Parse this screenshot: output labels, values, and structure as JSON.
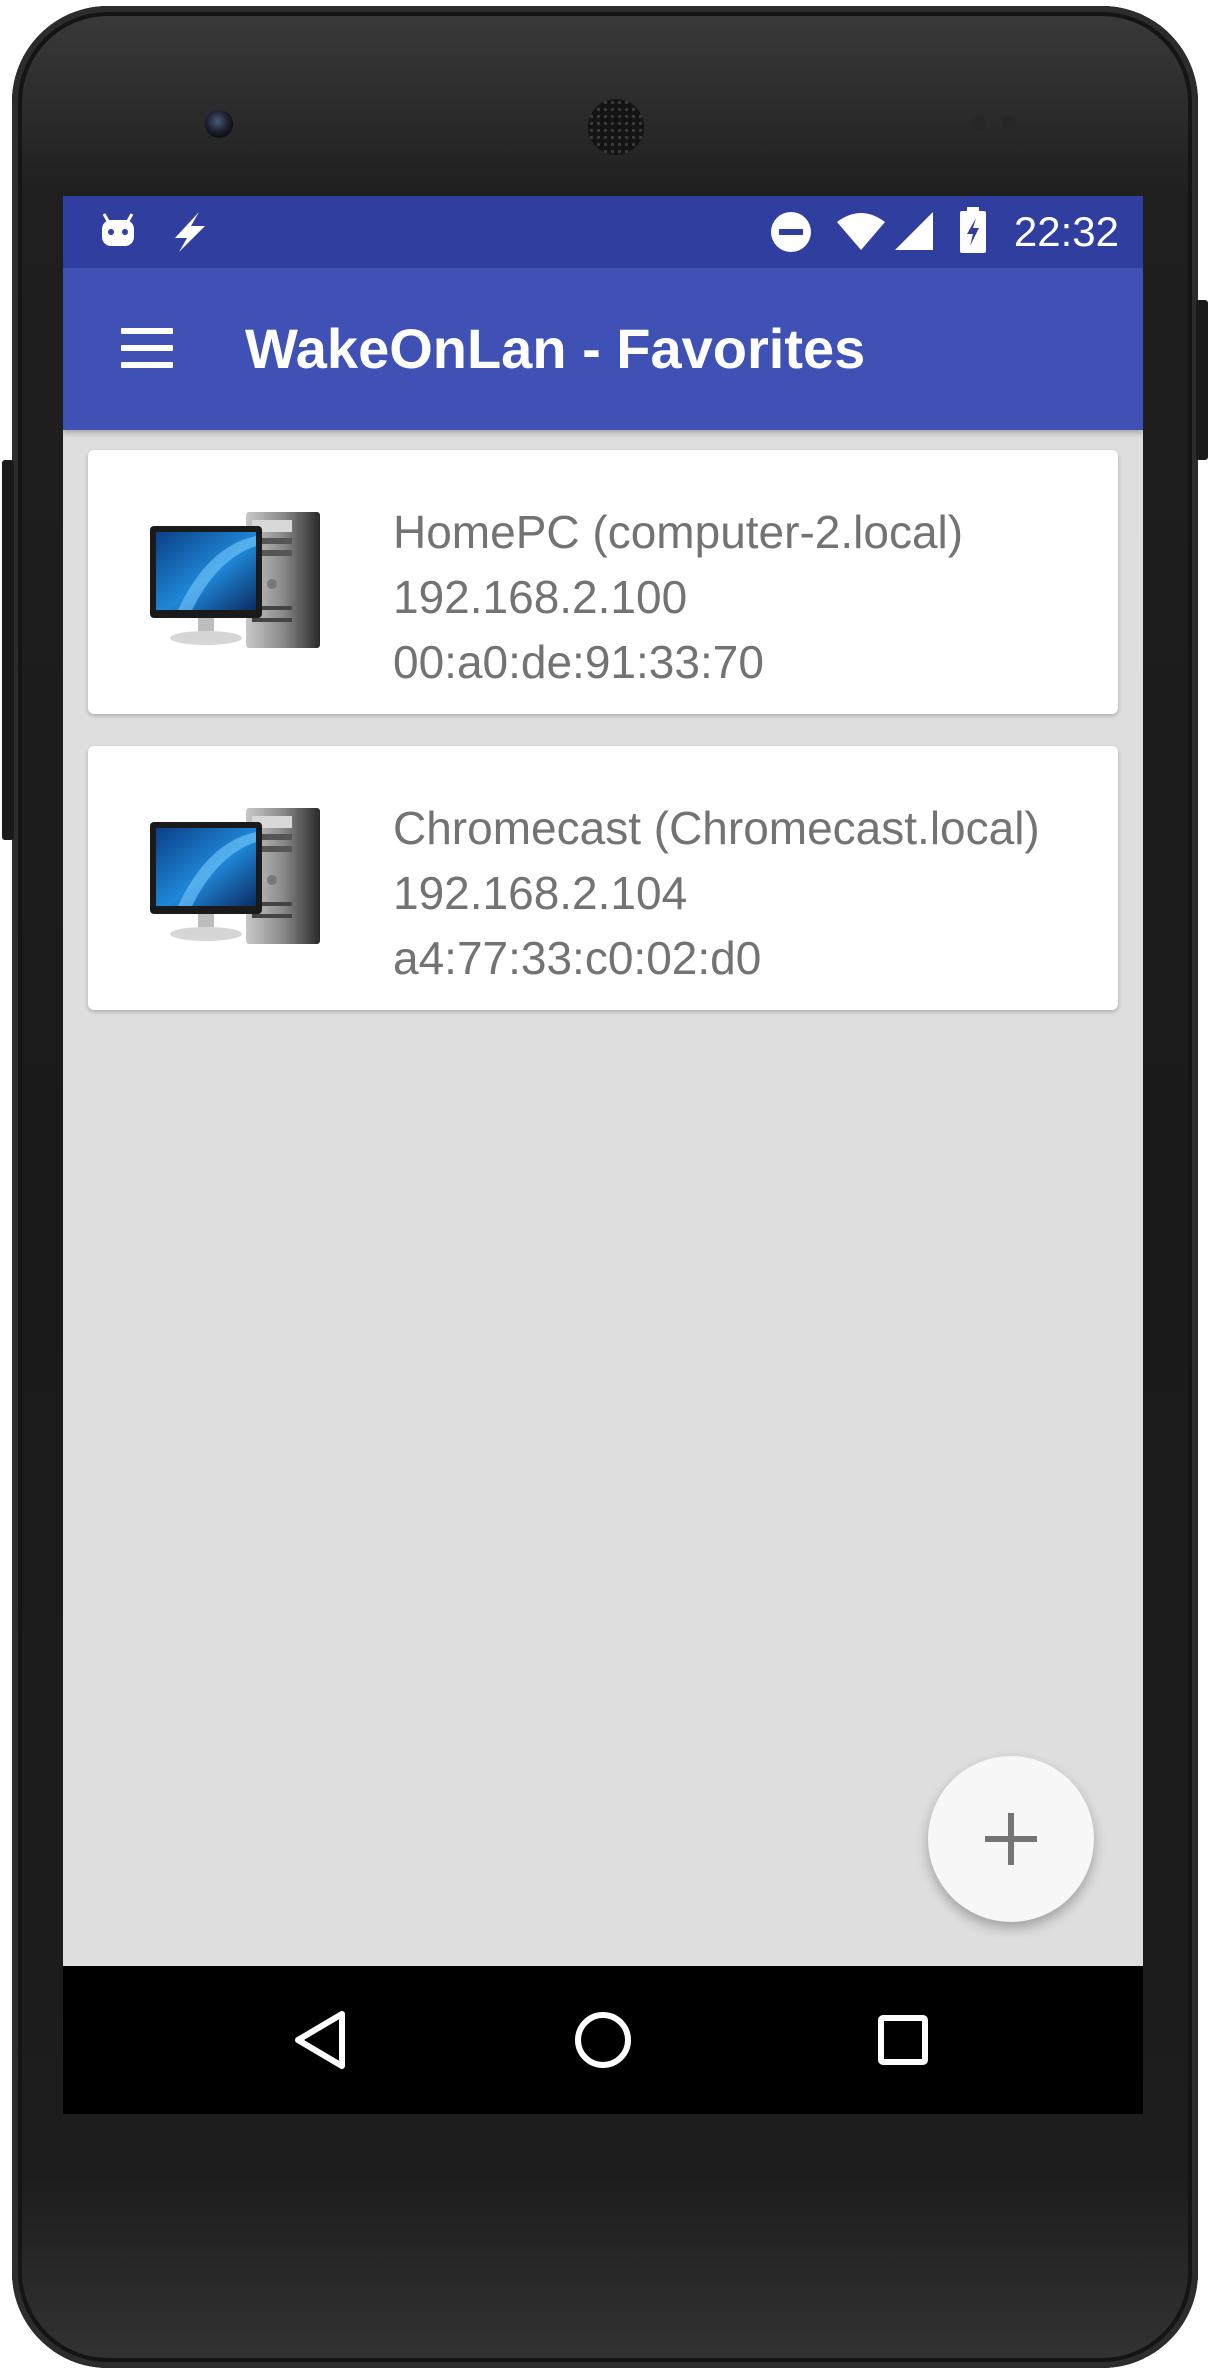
{
  "status_bar": {
    "time": "22:32",
    "left_icons": [
      "android-icon",
      "flash-icon"
    ],
    "right_icons": [
      "do-not-disturb-icon",
      "wifi-icon",
      "cell-signal-icon",
      "battery-charging-icon"
    ]
  },
  "toolbar": {
    "menu_icon": "hamburger-menu-icon",
    "title": "WakeOnLan - Favorites"
  },
  "favorites": [
    {
      "name": "HomePC (computer-2.local)",
      "ip": "192.168.2.100",
      "mac": "00:a0:de:91:33:70",
      "icon": "desktop-computer-icon"
    },
    {
      "name": "Chromecast (Chromecast.local)",
      "ip": "192.168.2.104",
      "mac": "a4:77:33:c0:02:d0",
      "icon": "desktop-computer-icon"
    }
  ],
  "fab": {
    "icon": "plus-icon"
  },
  "nav_bar": {
    "icons": [
      "back-icon",
      "home-icon",
      "recents-icon"
    ]
  },
  "colors": {
    "status_bar": "#303f9f",
    "toolbar": "#3f51b5",
    "background": "#dedede",
    "card": "#ffffff",
    "card_text": "#737373"
  }
}
